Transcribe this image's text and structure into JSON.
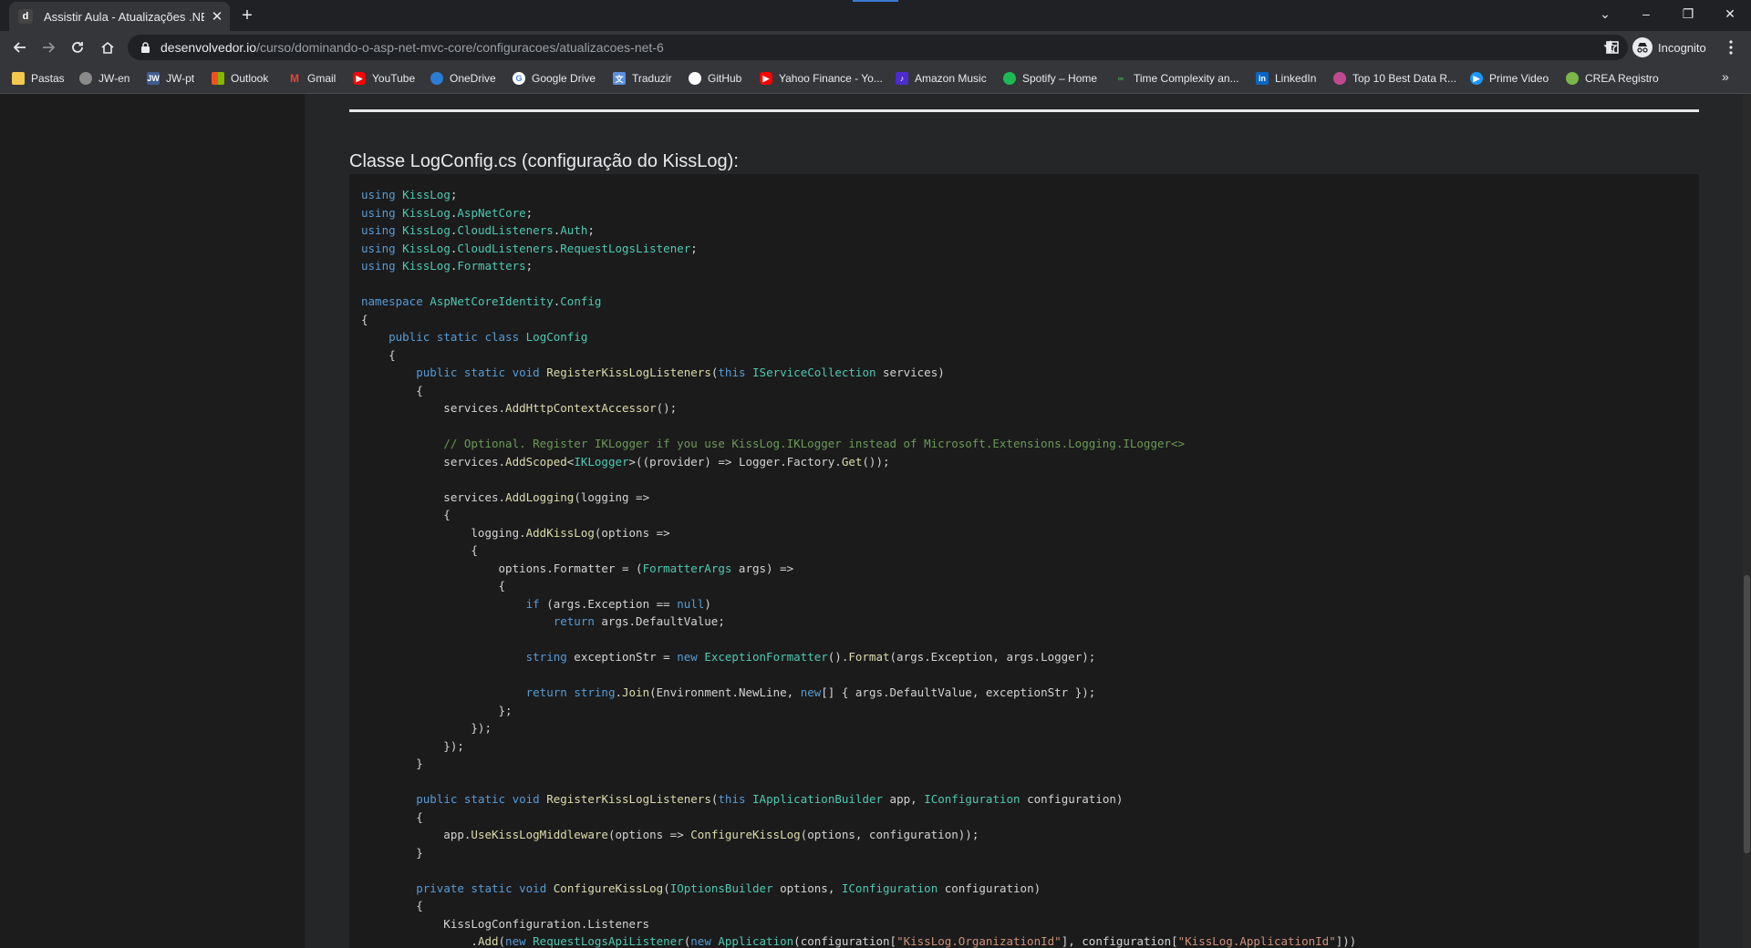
{
  "tab": {
    "title": "Assistir Aula - Atualizações .NET 6",
    "favicon_letter": "d"
  },
  "toolbar": {
    "url_host": "desenvolvedor.io",
    "url_path": "/curso/dominando-o-asp-net-mvc-core/configuracoes/atualizacoes-net-6",
    "profile_label": "Incognito"
  },
  "bookmarks": [
    {
      "label": "Pastas",
      "icon": "folder-icon",
      "color": "#f2c94c"
    },
    {
      "label": "JW-en",
      "icon": "globe-icon",
      "color": "#8a8a8a"
    },
    {
      "label": "JW-pt",
      "icon": "jw-icon",
      "color": "#3f5d8f"
    },
    {
      "label": "Outlook",
      "icon": "microsoft-icon",
      "color": "#f25022"
    },
    {
      "label": "Gmail",
      "icon": "gmail-icon",
      "color": "#ea4335"
    },
    {
      "label": "YouTube",
      "icon": "youtube-icon",
      "color": "#ff0000"
    },
    {
      "label": "OneDrive",
      "icon": "cloud-icon",
      "color": "#2b7cd3"
    },
    {
      "label": "Google Drive",
      "icon": "google-icon",
      "color": "#ffffff"
    },
    {
      "label": "Traduzir",
      "icon": "translate-icon",
      "color": "#5a8fdc"
    },
    {
      "label": "GitHub",
      "icon": "github-icon",
      "color": "#ffffff"
    },
    {
      "label": "Yahoo Finance - Yo...",
      "icon": "youtube-icon",
      "color": "#ff0000"
    },
    {
      "label": "Amazon Music",
      "icon": "amazon-music-icon",
      "color": "#4b2ccf"
    },
    {
      "label": "Spotify – Home",
      "icon": "spotify-icon",
      "color": "#1db954"
    },
    {
      "label": "Time Complexity an...",
      "icon": "link-icon",
      "color": "#3aa757"
    },
    {
      "label": "LinkedIn",
      "icon": "linkedin-icon",
      "color": "#0a66c2"
    },
    {
      "label": "Top 10 Best Data R...",
      "icon": "data-icon",
      "color": "#c04a8f"
    },
    {
      "label": "Prime Video",
      "icon": "prime-video-icon",
      "color": "#1a98ff"
    },
    {
      "label": "CREA Registro",
      "icon": "crea-icon",
      "color": "#7ab648"
    }
  ],
  "content": {
    "section_title": "Classe LogConfig.cs (configuração do KissLog):"
  }
}
